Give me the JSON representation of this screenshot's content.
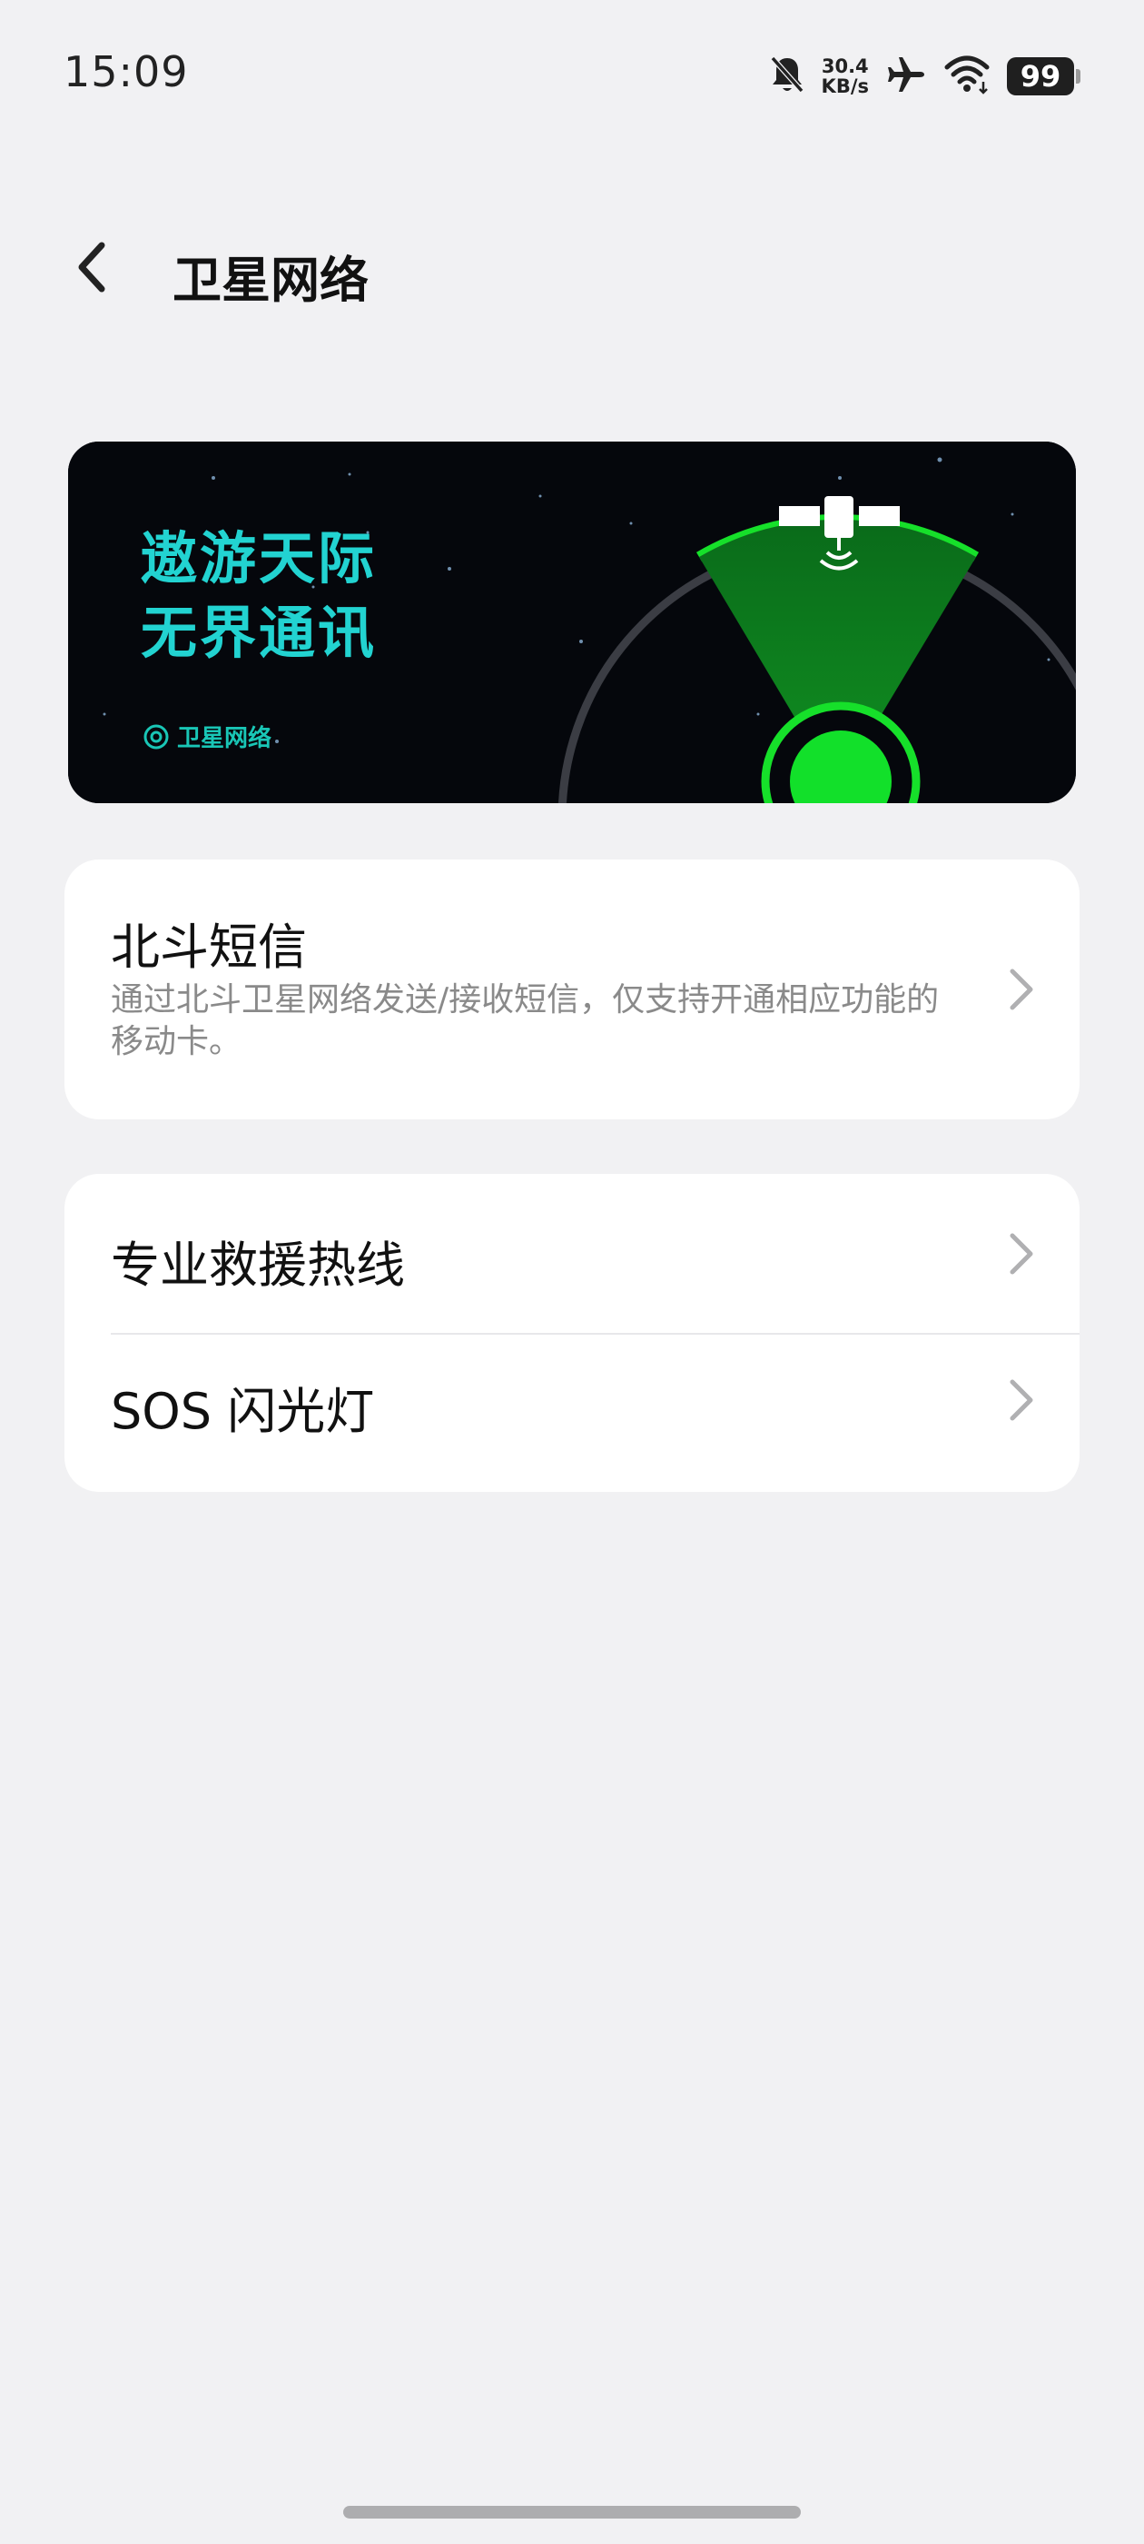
{
  "status_bar": {
    "time": "15:09",
    "net_speed_value": "30.4",
    "net_speed_unit": "KB/s",
    "battery": "99",
    "icons": [
      "bell-off-icon",
      "airplane-icon",
      "wifi-icon",
      "battery-icon"
    ]
  },
  "header": {
    "title": "卫星网络",
    "back_icon": "chevron-left-icon"
  },
  "banner": {
    "line1": "遨游天际",
    "line2": "无界通讯",
    "brand": "卫星网络",
    "colors": {
      "text": "#22d3d1",
      "beam": "#00e01a",
      "background": "#05070c"
    }
  },
  "cards": [
    {
      "items": [
        {
          "title": "北斗短信",
          "description": "通过北斗卫星网络发送/接收短信，仅支持开通相应功能的移动卡。",
          "icon": "chevron-right-icon"
        }
      ]
    },
    {
      "items": [
        {
          "title": "专业救援热线",
          "icon": "chevron-right-icon"
        },
        {
          "title": "SOS 闪光灯",
          "icon": "chevron-right-icon"
        }
      ]
    }
  ]
}
